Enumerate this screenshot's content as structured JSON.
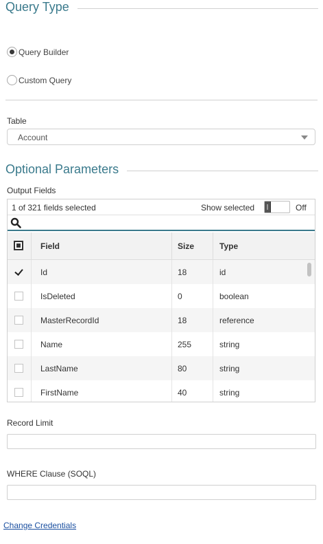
{
  "query_type": {
    "heading": "Query Type",
    "options": [
      {
        "label": "Query Builder",
        "checked": true
      },
      {
        "label": "Custom Query",
        "checked": false
      }
    ]
  },
  "table": {
    "label": "Table",
    "selected": "Account"
  },
  "optional_parameters": {
    "heading": "Optional Parameters",
    "output_fields_label": "Output Fields",
    "selection_count": "1 of 321 fields selected",
    "show_selected_label": "Show selected",
    "show_selected_state": "Off",
    "search_placeholder": "",
    "columns": [
      "Field",
      "Size",
      "Type"
    ],
    "rows": [
      {
        "checked": true,
        "field": "Id",
        "size": "18",
        "type": "id"
      },
      {
        "checked": false,
        "field": "IsDeleted",
        "size": "0",
        "type": "boolean"
      },
      {
        "checked": false,
        "field": "MasterRecordId",
        "size": "18",
        "type": "reference"
      },
      {
        "checked": false,
        "field": "Name",
        "size": "255",
        "type": "string"
      },
      {
        "checked": false,
        "field": "LastName",
        "size": "80",
        "type": "string"
      },
      {
        "checked": false,
        "field": "FirstName",
        "size": "40",
        "type": "string"
      }
    ],
    "record_limit_label": "Record Limit",
    "record_limit_value": "",
    "where_clause_label": "WHERE Clause (SOQL)",
    "where_clause_value": ""
  },
  "change_credentials_label": "Change Credentials",
  "colors": {
    "heading": "#3a7a8c",
    "link": "#1a4fa0"
  }
}
